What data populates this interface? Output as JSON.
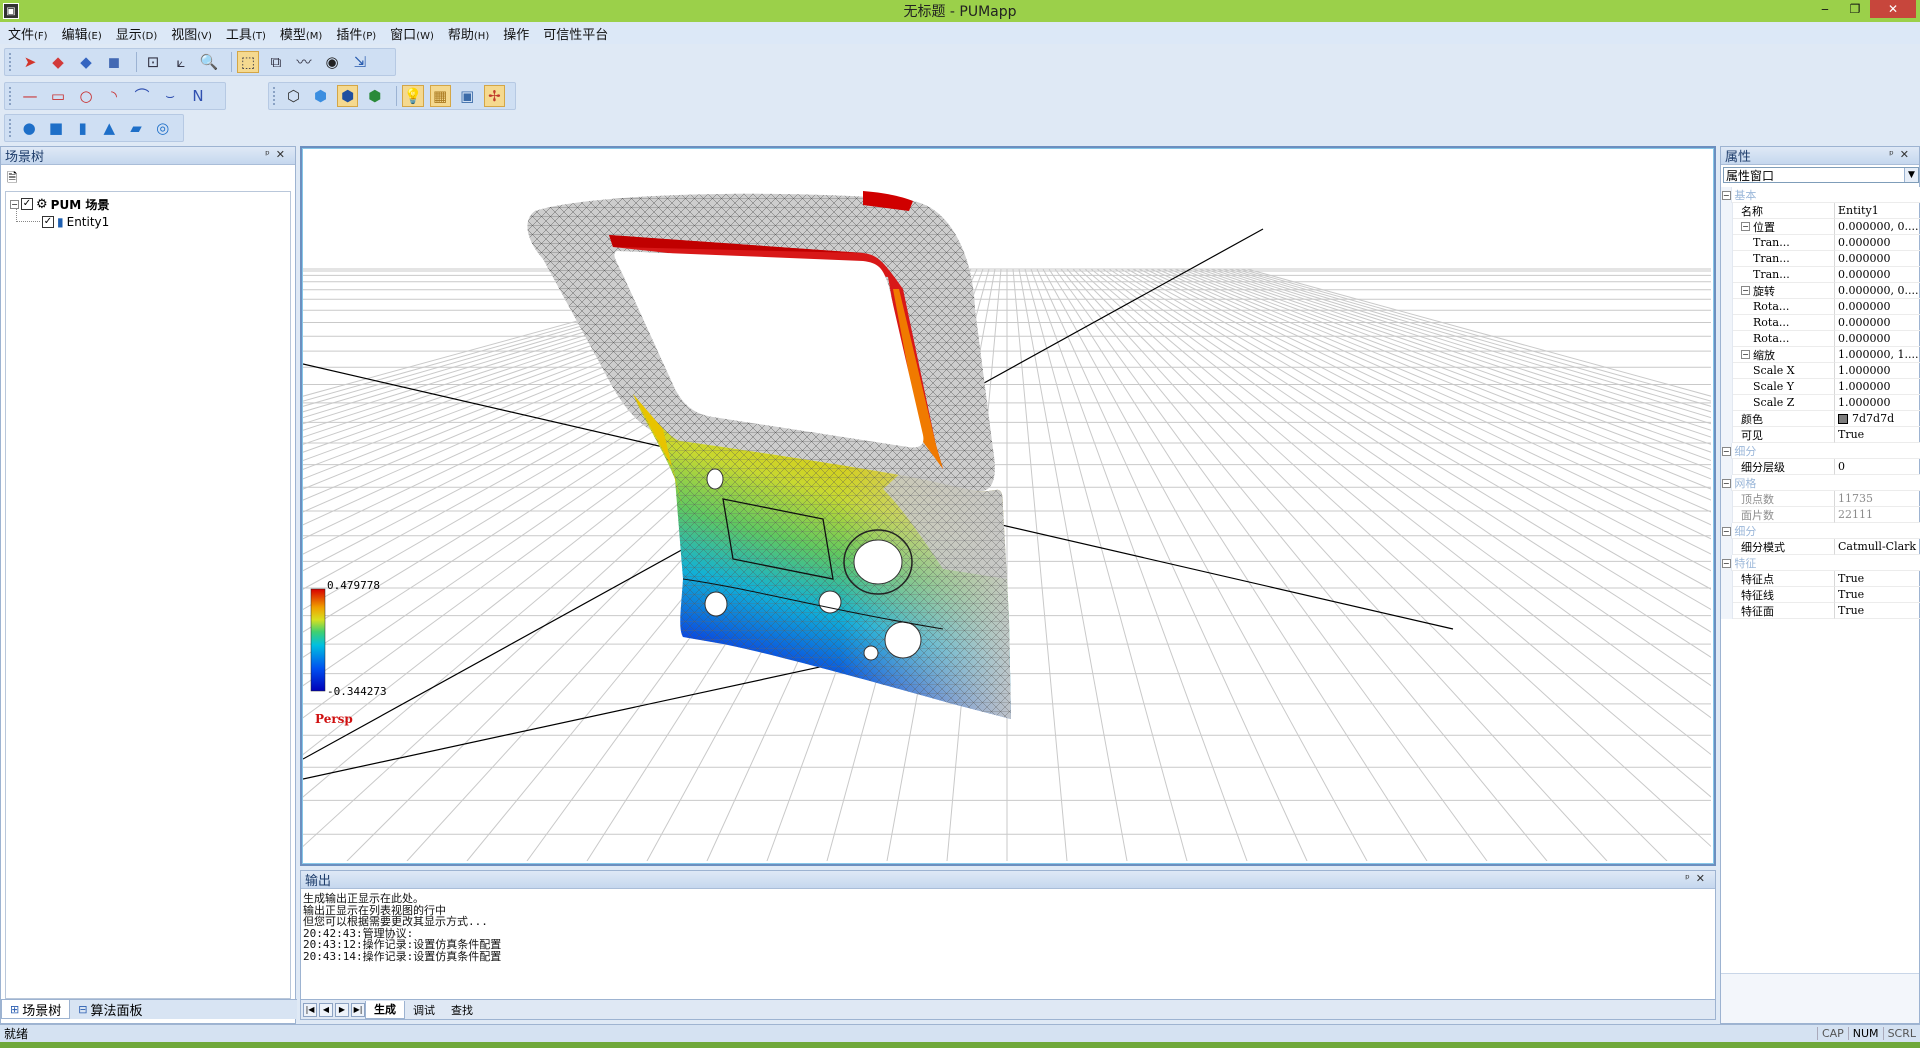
{
  "window": {
    "title": "无标题 - PUMapp",
    "minimize": "‒",
    "restore": "❐",
    "close": "✕"
  },
  "menu": [
    {
      "label": "文件",
      "accel": "(F)"
    },
    {
      "label": "编辑",
      "accel": "(E)"
    },
    {
      "label": "显示",
      "accel": "(D)"
    },
    {
      "label": "视图",
      "accel": "(V)"
    },
    {
      "label": "工具",
      "accel": "(T)"
    },
    {
      "label": "模型",
      "accel": "(M)"
    },
    {
      "label": "插件",
      "accel": "(P)"
    },
    {
      "label": "窗口",
      "accel": "(W)"
    },
    {
      "label": "帮助",
      "accel": "(H)"
    },
    {
      "label": "操作",
      "accel": ""
    },
    {
      "label": "可信性平台",
      "accel": ""
    }
  ],
  "toolbars": {
    "main": [
      {
        "name": "select-arrow-icon",
        "glyph": "➤",
        "color": "#d2352b"
      },
      {
        "name": "model-red-icon",
        "glyph": "◆",
        "color": "#d23a3a"
      },
      {
        "name": "model-shape-icon",
        "glyph": "◆",
        "color": "#3565c0"
      },
      {
        "name": "model-cube-icon",
        "glyph": "◼",
        "color": "#4369b4"
      },
      {
        "name": "zoom-window-icon",
        "glyph": "⊡",
        "color": "#334"
      },
      {
        "name": "axis-icon",
        "glyph": "⟀",
        "color": "#334"
      },
      {
        "name": "zoom-icon",
        "glyph": "🔍",
        "color": "#334"
      },
      {
        "name": "select-box-icon",
        "glyph": "⬚",
        "color": "#334",
        "active": true
      },
      {
        "name": "fit-view-icon",
        "glyph": "⧉",
        "color": "#334"
      },
      {
        "name": "measure-icon",
        "glyph": "〰",
        "color": "#334"
      },
      {
        "name": "eye-icon",
        "glyph": "◉",
        "color": "#222"
      },
      {
        "name": "transform-icon",
        "glyph": "⇲",
        "color": "#2a5db0"
      }
    ],
    "sketch": [
      {
        "name": "line-icon",
        "glyph": "—",
        "color": "#c83030"
      },
      {
        "name": "rectangle-icon",
        "glyph": "▭",
        "color": "#c83030"
      },
      {
        "name": "circle-icon",
        "glyph": "○",
        "color": "#c83030"
      },
      {
        "name": "arc-icon",
        "glyph": "◝",
        "color": "#c83030"
      },
      {
        "name": "curve-icon",
        "glyph": "⌒",
        "color": "#3050b0"
      },
      {
        "name": "spline-icon",
        "glyph": "⌣",
        "color": "#3050b0"
      },
      {
        "name": "polyline-icon",
        "glyph": "N",
        "color": "#3050b0"
      }
    ],
    "display": [
      {
        "name": "wireframe-cube-icon",
        "glyph": "⬡",
        "color": "#333"
      },
      {
        "name": "shaded-cube-icon",
        "glyph": "⬢",
        "color": "#3b8ee0"
      },
      {
        "name": "shaded-edges-icon",
        "glyph": "⬢",
        "color": "#1f4fa0",
        "active": true
      },
      {
        "name": "solid-color-icon",
        "glyph": "⬢",
        "color": "#2a8a3a"
      },
      {
        "name": "light-icon",
        "glyph": "💡",
        "color": "#d0a020",
        "active": true
      },
      {
        "name": "grid-icon",
        "glyph": "▦",
        "color": "#aa7a20",
        "active": true
      },
      {
        "name": "view-cube-icon",
        "glyph": "▣",
        "color": "#3a6aa8"
      },
      {
        "name": "axes-icon",
        "glyph": "✢",
        "color": "#c0392b",
        "active": true
      }
    ],
    "primitives": [
      {
        "name": "sphere-icon",
        "glyph": "●",
        "color": "#1e6fc8"
      },
      {
        "name": "cube-icon",
        "glyph": "■",
        "color": "#1e6fc8"
      },
      {
        "name": "cylinder-icon",
        "glyph": "▮",
        "color": "#1e6fc8"
      },
      {
        "name": "cone-icon",
        "glyph": "▲",
        "color": "#1e6fc8"
      },
      {
        "name": "plane-icon",
        "glyph": "▰",
        "color": "#1e6fc8"
      },
      {
        "name": "torus-icon",
        "glyph": "◎",
        "color": "#1e6fc8"
      }
    ]
  },
  "scene_tree": {
    "title": "场景树",
    "pin": "ᵖ",
    "close": "✕",
    "root_label": "PUM 场景",
    "child_label": "Entity1"
  },
  "left_tabs": {
    "scene_tree": "场景树",
    "algorithm_panel": "算法面板"
  },
  "viewport": {
    "legend_max": "0.479778",
    "legend_min": "-0.344273",
    "projection": "Persp"
  },
  "output": {
    "title": "输出",
    "lines": [
      "生成输出正显示在此处。",
      "输出正显示在列表视图的行中",
      "但您可以根据需要更改其显示方式...",
      "20:42:43:管理协议:",
      "20:43:12:操作记录:设置仿真条件配置",
      "20:43:14:操作记录:设置仿真条件配置"
    ],
    "tabs": [
      "生成",
      "调试",
      "查找"
    ],
    "nav": [
      "|◀",
      "◀",
      "▶",
      "▶|"
    ]
  },
  "properties": {
    "title": "属性",
    "selector": "属性窗口",
    "rows": [
      {
        "type": "cat",
        "k": "基本"
      },
      {
        "k": "名称",
        "v": "Entity1",
        "indent": 1
      },
      {
        "k": "位置",
        "v": "0.000000, 0....",
        "indent": 1,
        "exp": true
      },
      {
        "k": "Tran...",
        "v": "0.000000",
        "indent": 3
      },
      {
        "k": "Tran...",
        "v": "0.000000",
        "indent": 3
      },
      {
        "k": "Tran...",
        "v": "0.000000",
        "indent": 3
      },
      {
        "k": "旋转",
        "v": "0.000000, 0....",
        "indent": 1,
        "exp": true
      },
      {
        "k": "Rota...",
        "v": "0.000000",
        "indent": 3
      },
      {
        "k": "Rota...",
        "v": "0.000000",
        "indent": 3
      },
      {
        "k": "Rota...",
        "v": "0.000000",
        "indent": 3
      },
      {
        "k": "缩放",
        "v": "1.000000, 1....",
        "indent": 1,
        "exp": true
      },
      {
        "k": "Scale X",
        "v": "1.000000",
        "indent": 3
      },
      {
        "k": "Scale Y",
        "v": "1.000000",
        "indent": 3
      },
      {
        "k": "Scale Z",
        "v": "1.000000",
        "indent": 3
      },
      {
        "k": "颜色",
        "v": "7d7d7d",
        "indent": 1,
        "swatch": "#7d7d7d"
      },
      {
        "k": "可见",
        "v": "True",
        "indent": 1
      },
      {
        "type": "cat",
        "k": "细分"
      },
      {
        "k": "细分层级",
        "v": "0",
        "indent": 1
      },
      {
        "type": "cat",
        "k": "网格"
      },
      {
        "k": "顶点数",
        "v": "11735",
        "indent": 1,
        "dim": true
      },
      {
        "k": "面片数",
        "v": "22111",
        "indent": 1,
        "dim": true
      },
      {
        "type": "cat",
        "k": "细分"
      },
      {
        "k": "细分模式",
        "v": "Catmull-Clark",
        "indent": 1
      },
      {
        "type": "cat",
        "k": "特征"
      },
      {
        "k": "特征点",
        "v": "True",
        "indent": 1
      },
      {
        "k": "特征线",
        "v": "True",
        "indent": 1
      },
      {
        "k": "特征面",
        "v": "True",
        "indent": 1
      }
    ]
  },
  "status": {
    "ready": "就绪",
    "indicators": [
      "CAP",
      "NUM",
      "SCRL"
    ]
  }
}
